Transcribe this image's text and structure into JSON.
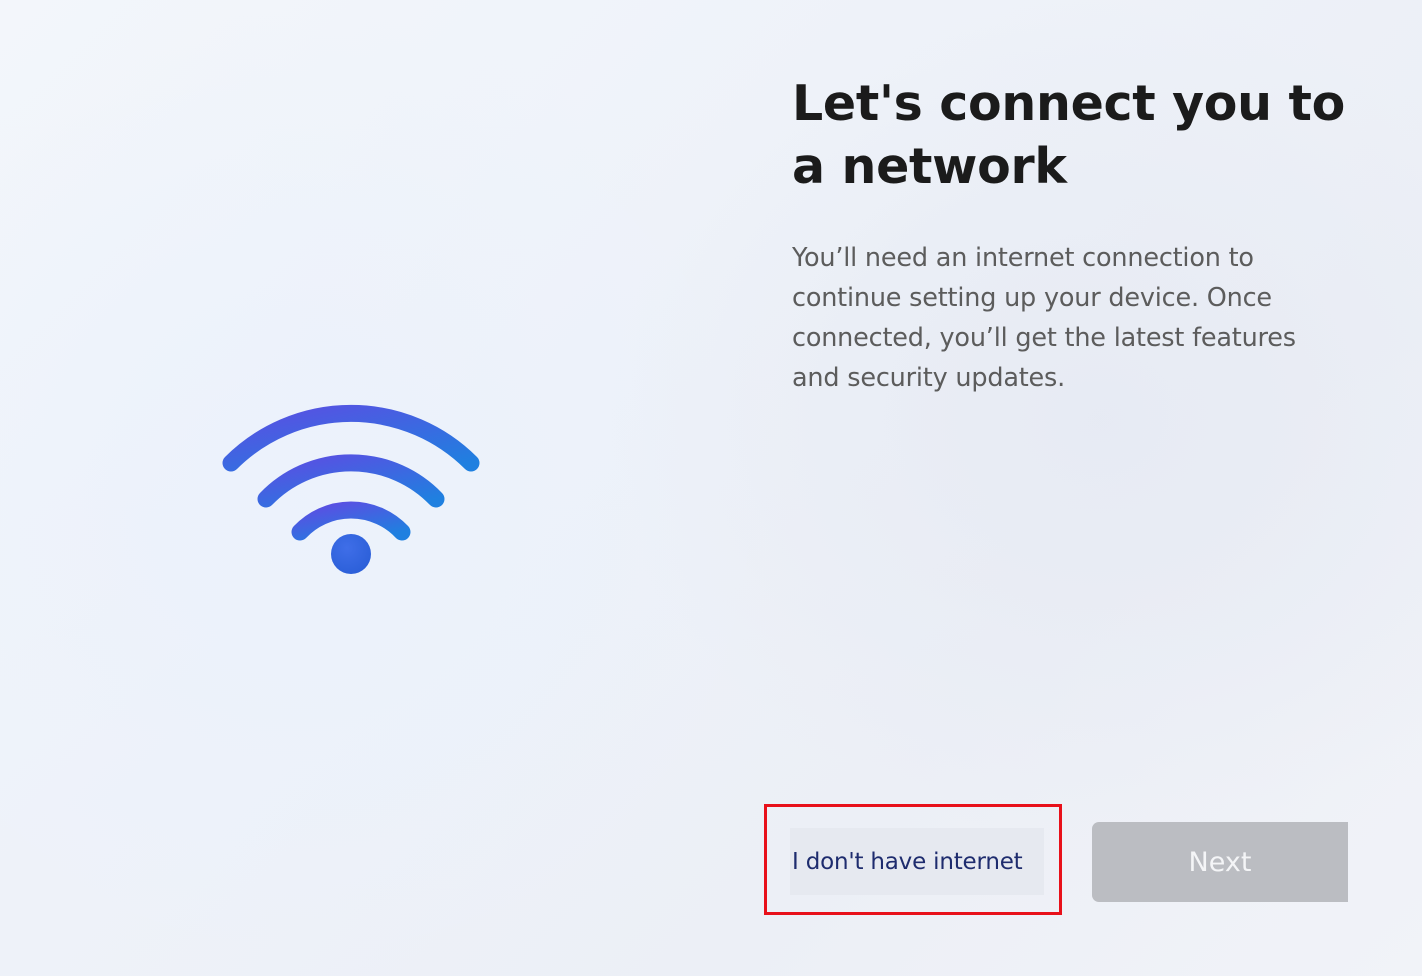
{
  "header": {
    "title": "Let's connect you to a network"
  },
  "main": {
    "description": "You’ll need an internet connection to continue setting up your device. Once connected, you’ll get the latest features and security updates."
  },
  "illustration": {
    "icon": "wifi-icon",
    "colors": {
      "gradient_start": "#5b4fe0",
      "gradient_end": "#1f7fe0"
    }
  },
  "footer": {
    "no_internet_label": "I don't have internet",
    "next_label": "Next",
    "next_enabled": false,
    "highlight_color": "#e8101a"
  }
}
